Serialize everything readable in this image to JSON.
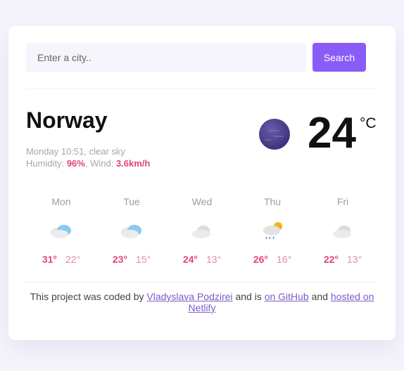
{
  "search": {
    "placeholder": "Enter a city..",
    "button_label": "Search"
  },
  "current": {
    "city": "Norway",
    "day_time": "Monday 10:51",
    "description": "clear sky",
    "humidity_label": "Humidity:",
    "humidity": "96%",
    "wind_label": "Wind:",
    "wind": "3.6km/h",
    "temperature": "24",
    "unit": "°C",
    "icon": "moon-icon"
  },
  "forecast": [
    {
      "day": "Mon",
      "max": "31°",
      "min": "22°",
      "icon": "cloud-rain-icon"
    },
    {
      "day": "Tue",
      "max": "23°",
      "min": "15°",
      "icon": "cloud-rain-icon"
    },
    {
      "day": "Wed",
      "max": "24°",
      "min": "13°",
      "icon": "cloud-icon"
    },
    {
      "day": "Thu",
      "max": "26°",
      "min": "16°",
      "icon": "sun-cloud-rain-icon"
    },
    {
      "day": "Fri",
      "max": "22°",
      "min": "13°",
      "icon": "cloud-icon"
    }
  ],
  "footer": {
    "text_1": "This project was coded by",
    "author": "Vladyslava Podzirei",
    "text_2": "and is",
    "github": "on GitHub",
    "text_3": "and",
    "netlify": "hosted on Netlify"
  },
  "colors": {
    "accent": "#8a5cf6",
    "highlight": "#e0457b"
  }
}
